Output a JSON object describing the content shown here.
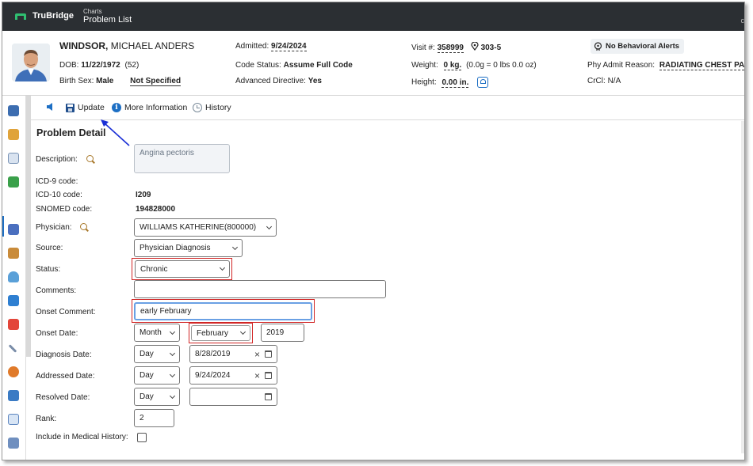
{
  "app": {
    "brand": "TruBridge",
    "breadcrumb_small": "Charts",
    "breadcrumb_title": "Problem List",
    "top_right_glyph": "c"
  },
  "patient": {
    "last_name": "WINDSOR,",
    "first_name": "MICHAEL ANDERS",
    "dob_label": "DOB:",
    "dob": "11/22/1972",
    "age": "(52)",
    "birth_sex_label": "Birth Sex:",
    "birth_sex": "Male",
    "gender_identity": "Not Specified",
    "admitted_label": "Admitted:",
    "admitted": "9/24/2024",
    "code_status_label": "Code Status:",
    "code_status": "Assume Full Code",
    "advanced_directive_label": "Advanced Directive:",
    "advanced_directive": "Yes",
    "visit_label": "Visit #:",
    "visit": "358999",
    "room": "303-5",
    "weight_label": "Weight:",
    "weight": "0 kg.",
    "weight_note": "(0.0g = 0 lbs 0.0 oz)",
    "height_label": "Height:",
    "height": "0.00 in.",
    "alert_chip": "No Behavioral Alerts",
    "admit_reason_label": "Phy Admit Reason:",
    "admit_reason": "RADIATING CHEST PAIN",
    "crcl_label": "CrCl:",
    "crcl": "N/A"
  },
  "toolbar": {
    "update": "Update",
    "more_info": "More Information",
    "history": "History"
  },
  "form": {
    "title": "Problem Detail",
    "description_label": "Description:",
    "description": "Angina pectoris",
    "icd9_label": "ICD-9 code:",
    "icd9": "",
    "icd10_label": "ICD-10 code:",
    "icd10": "I209",
    "snomed_label": "SNOMED code:",
    "snomed": "194828000",
    "physician_label": "Physician:",
    "physician": "WILLIAMS KATHERINE(800000)",
    "source_label": "Source:",
    "source": "Physician Diagnosis",
    "status_label": "Status:",
    "status": "Chronic",
    "comments_label": "Comments:",
    "comments": "",
    "onset_comment_label": "Onset Comment:",
    "onset_comment": "early February",
    "onset_date_label": "Onset Date:",
    "onset_precision": "Month",
    "onset_month": "February",
    "onset_year": "2019",
    "diagnosis_date_label": "Diagnosis Date:",
    "diagnosis_precision": "Day",
    "diagnosis_date": "8/28/2019",
    "addressed_date_label": "Addressed Date:",
    "addressed_precision": "Day",
    "addressed_date": "9/24/2024",
    "resolved_date_label": "Resolved Date:",
    "resolved_precision": "Day",
    "resolved_date": "",
    "rank_label": "Rank:",
    "rank": "2",
    "include_history_label": "Include in Medical History:",
    "include_history_checked": false
  },
  "colors": {
    "topbar": "#2b2f33",
    "accent": "#1d6fc4",
    "highlight_box": "#d12626",
    "annotation_arrow": "#1a2fd6"
  }
}
